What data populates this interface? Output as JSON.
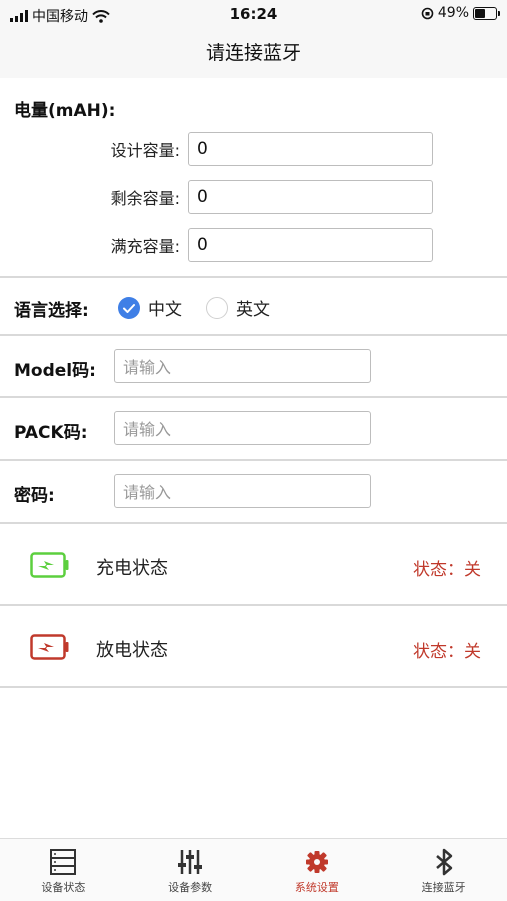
{
  "status_bar": {
    "carrier": "中国移动",
    "time": "16:24",
    "battery_percent": "49%",
    "battery_level": 0.49
  },
  "nav": {
    "title": "请连接蓝牙"
  },
  "capacity": {
    "heading": "电量(mAH):",
    "design_label": "设计容量:",
    "design_value": "0",
    "remaining_label": "剩余容量:",
    "remaining_value": "0",
    "full_label": "满充容量:",
    "full_value": "0"
  },
  "language": {
    "label": "语言选择:",
    "options": [
      "中文",
      "英文"
    ],
    "selected": "中文"
  },
  "model": {
    "label": "Model码:",
    "placeholder": "请输入"
  },
  "pack": {
    "label": "PACK码:",
    "placeholder": "请输入"
  },
  "password": {
    "label": "密码:",
    "placeholder": "请输入"
  },
  "charge": {
    "title": "充电状态",
    "status": "状态：关",
    "color": "#5ccf3e"
  },
  "discharge": {
    "title": "放电状态",
    "status": "状态：关",
    "color": "#c0392b"
  },
  "tabs": [
    {
      "label": "设备状态",
      "icon": "device-status-icon"
    },
    {
      "label": "设备参数",
      "icon": "sliders-icon"
    },
    {
      "label": "系统设置",
      "icon": "gear-icon",
      "active": true
    },
    {
      "label": "连接蓝牙",
      "icon": "bluetooth-icon"
    }
  ],
  "colors": {
    "accent": "#3f7fe6",
    "active_tab": "#c0392b",
    "status_off": "#c0392b"
  }
}
